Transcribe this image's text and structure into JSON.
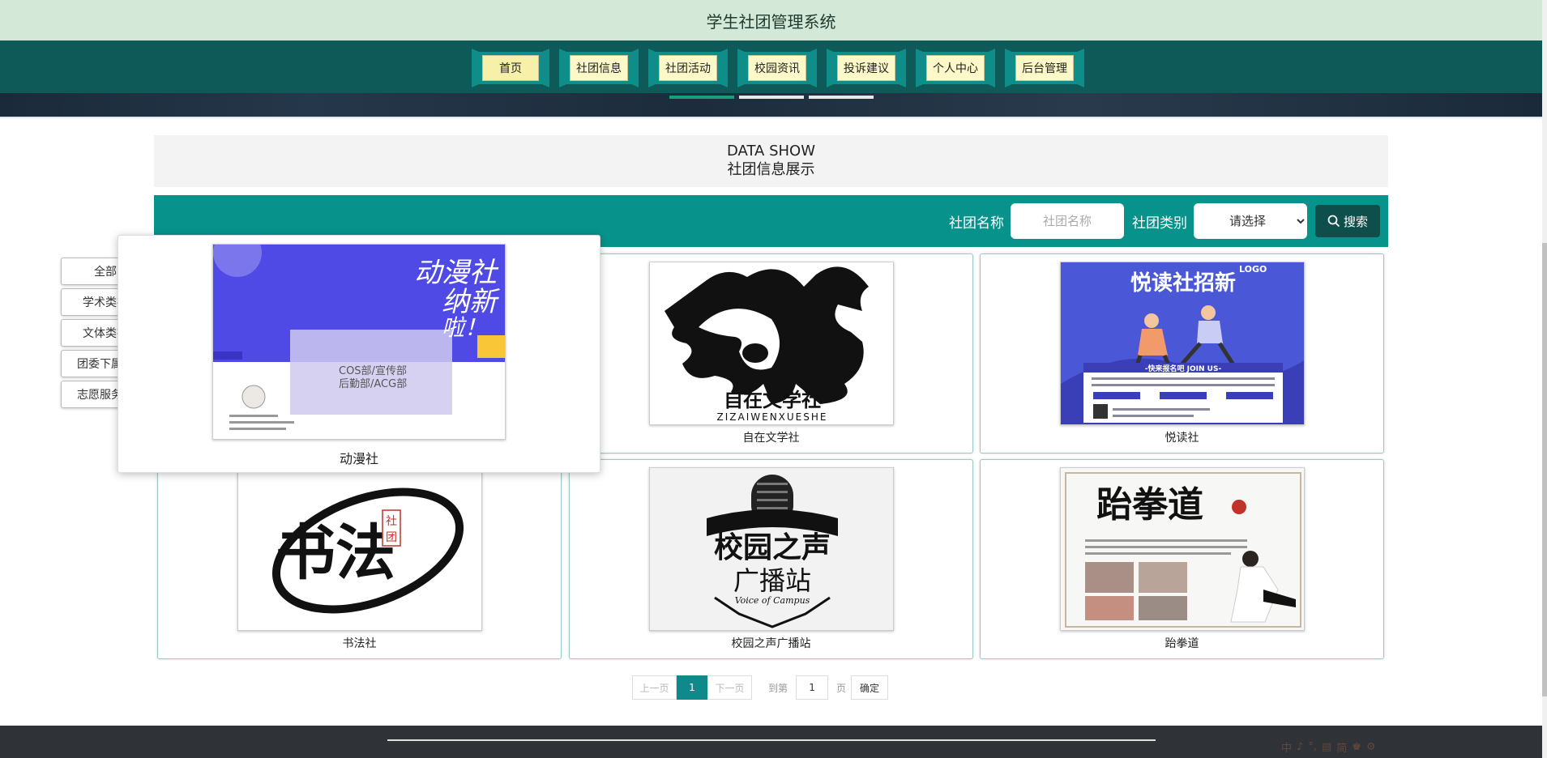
{
  "header": {
    "title": "学生社团管理系统"
  },
  "nav": {
    "items": [
      {
        "label": "首页",
        "active": true
      },
      {
        "label": "社团信息"
      },
      {
        "label": "社团活动"
      },
      {
        "label": "校园资讯"
      },
      {
        "label": "投诉建议"
      },
      {
        "label": "个人中心"
      },
      {
        "label": "后台管理"
      }
    ]
  },
  "section": {
    "title_en": "DATA SHOW",
    "title_cn": "社团信息展示"
  },
  "search": {
    "name_label": "社团名称",
    "name_placeholder": "社团名称",
    "category_label": "社团类别",
    "category_selected": "请选择",
    "button_label": "搜索"
  },
  "categories": [
    "全部",
    "学术类社",
    "文体类社",
    "团委下属组",
    "志愿服务组"
  ],
  "cards": [
    {
      "name": "动漫社",
      "poster": {
        "line1": "动漫社",
        "line2": "纳新",
        "line3": "啦！",
        "sub1": "COS部/宣传部",
        "sub2": "后勤部/ACG部"
      }
    },
    {
      "name": "自在文学社",
      "poster": {
        "cn": "自在文学社",
        "en": "ZIZAIWENXUESHE"
      }
    },
    {
      "name": "悦读社",
      "poster": {
        "title": "悦读社招新",
        "logo": "LOGO",
        "banner": "-快来报名吧 JOIN US-"
      }
    },
    {
      "name": "书法社",
      "poster": {
        "big": "书法",
        "tag": "社团"
      }
    },
    {
      "name": "校园之声广播站",
      "poster": {
        "line1": "校园之声",
        "line2": "广播站",
        "en": "Voice of Campus"
      }
    },
    {
      "name": "跆拳道",
      "poster": {
        "title": "跆拳道"
      }
    }
  ],
  "pagination": {
    "prev": "上一页",
    "current": "1",
    "next": "下一页",
    "goto": "到第",
    "page_value": "1",
    "unit": "页",
    "confirm": "确定"
  },
  "footer": {
    "ime": [
      "中",
      "♪",
      "°,",
      "▤",
      "简",
      "♚",
      "⚙"
    ]
  },
  "colors": {
    "title_bar": "#d4e8d8",
    "nav_bar": "#0e5a58",
    "search_bar": "#07928c",
    "page_active": "#10898a",
    "footer": "#2f3236"
  }
}
